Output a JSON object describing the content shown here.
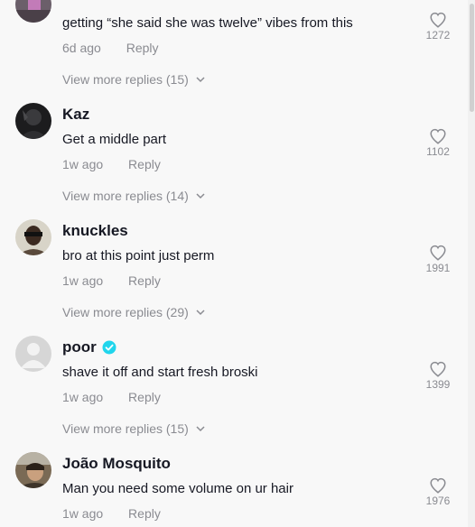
{
  "comments": [
    {
      "username": ".",
      "text": "getting “she said she was twelve” vibes from this",
      "time": "6d ago",
      "reply": "Reply",
      "likes": "1272",
      "view_replies": "View more replies (15)",
      "verified": false
    },
    {
      "username": "Kaz",
      "text": "Get a middle part",
      "time": "1w ago",
      "reply": "Reply",
      "likes": "1102",
      "view_replies": "View more replies (14)",
      "verified": false
    },
    {
      "username": "knuckles",
      "text": "bro at this point just perm",
      "time": "1w ago",
      "reply": "Reply",
      "likes": "1991",
      "view_replies": "View more replies (29)",
      "verified": false
    },
    {
      "username": "poor",
      "text": "shave it off and start fresh broski",
      "time": "1w ago",
      "reply": "Reply",
      "likes": "1399",
      "view_replies": "View more replies (15)",
      "verified": true
    },
    {
      "username": "João Mosquito",
      "text": "Man you need some volume on ur hair",
      "time": "1w ago",
      "reply": "Reply",
      "likes": "1976",
      "verified": false
    }
  ],
  "colors": {
    "text": "#161823",
    "muted": "#8a8b91",
    "verified": "#20d5ec",
    "background": "#f8f8f8"
  }
}
